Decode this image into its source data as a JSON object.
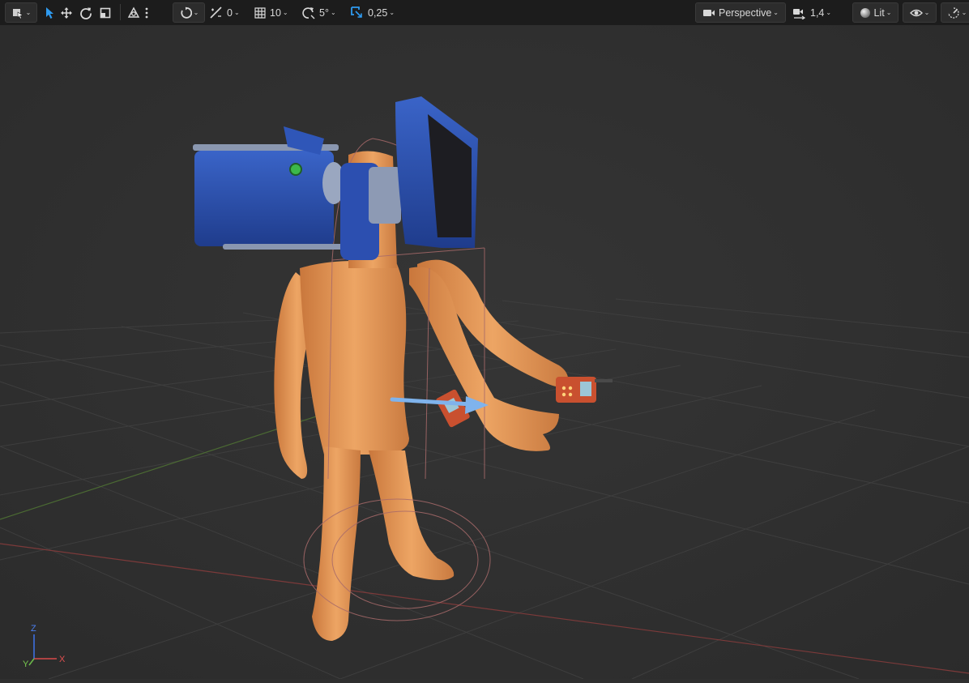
{
  "toolbar": {
    "snap_translate_value": "0",
    "grid_value": "10",
    "rotation_snap_value": "5°",
    "scale_snap_value": "0,25",
    "viewport_mode_label": "Perspective",
    "camera_speed_value": "1,4",
    "view_mode_label": "Lit"
  },
  "axis_gizmo": {
    "x_label": "X",
    "y_label": "Y",
    "z_label": "Z"
  },
  "colors": {
    "toolbar_bg": "#1c1c1c",
    "viewport_bg": "#2f2f2f",
    "grid_line": "#3d3d3d",
    "x_axis": "#b84a4a",
    "y_axis": "#5e8a3a",
    "accent_blue": "#2f9bf0",
    "character_skin": "#e29a58",
    "camera_blue": "#2a4fb0",
    "device_orange": "#c9502f"
  },
  "icons": [
    "select-mode-icon",
    "chevron-down-icon",
    "select-arrow-icon",
    "move-icon",
    "rotate-icon",
    "scale-icon",
    "transform-options-icon",
    "more-options-icon",
    "world-local-icon",
    "snap-surface-icon",
    "grid-snap-icon",
    "rotation-snap-icon",
    "scale-snap-icon",
    "camera-icon",
    "camera-speed-icon",
    "lit-sphere-icon",
    "eye-icon",
    "viewport-settings-icon"
  ]
}
